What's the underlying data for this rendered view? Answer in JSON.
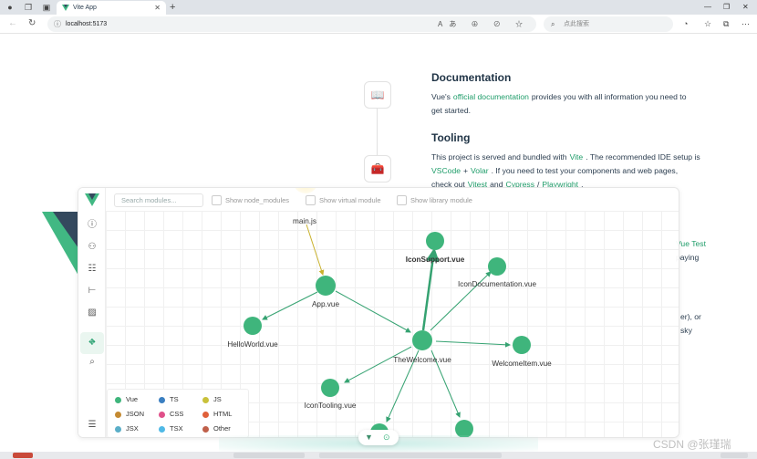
{
  "browser": {
    "tab_title": "Vite App",
    "url": "localhost:5173",
    "search_placeholder": "点此搜索"
  },
  "page": {
    "documentation_title": "Documentation",
    "doc_text_1": "Vue's",
    "doc_link": "official documentation",
    "doc_text_2": "provides you with all information you need to",
    "doc_text_3": "get started.",
    "tooling_title": "Tooling",
    "tool_line_1a": "This project is served and bundled with",
    "tool_vite": "Vite",
    "tool_line_1b": ". The recommended IDE setup is",
    "tool_vscode": "VSCode",
    "tool_plus": "+",
    "tool_volar": "Volar",
    "tool_line_2b": ". If you need to test your components and web pages,",
    "tool_line_3a": "check out",
    "tool_vitest": "Vitest",
    "tool_and": "and",
    "tool_cypress": "Cypress",
    "tool_slash": "/",
    "tool_playwright": "Playwright",
    "tool_dot": ".",
    "frag_vuetest": "Vue Test",
    "frag_paying": "paying",
    "frag_er": "er), or",
    "frag_sky": "sky"
  },
  "devtools": {
    "search_placeholder": "Search modules...",
    "show_node_modules": "Show node_modules",
    "show_virtual_module": "Show virtual module",
    "show_library_module": "Show library module",
    "nodes": {
      "main": "main.js",
      "app": "App.vue",
      "helloworld": "HelloWorld.vue",
      "welcome": "TheWelcome.vue",
      "iconsupport": "IconSupport.vue",
      "icondoc": "IconDocumentation.vue",
      "welcomeitem": "WelcomeItem.vue",
      "icontooling": "IconTooling.vue"
    },
    "legend": [
      {
        "label": "Vue",
        "color": "#3fb57c"
      },
      {
        "label": "TS",
        "color": "#3a7fc1"
      },
      {
        "label": "JS",
        "color": "#c9c13a"
      },
      {
        "label": "JSON",
        "color": "#c48a32"
      },
      {
        "label": "CSS",
        "color": "#e0508a"
      },
      {
        "label": "HTML",
        "color": "#e0603a"
      },
      {
        "label": "JSX",
        "color": "#5aaec8"
      },
      {
        "label": "TSX",
        "color": "#4fb9e6"
      },
      {
        "label": "Other",
        "color": "#c0604a"
      }
    ]
  },
  "watermark": "CSDN @张瑾瑞",
  "colors": {
    "vue_green": "#41b883",
    "link_green": "#1f9d6a",
    "edge_green": "#35a271",
    "main_edge": "#c9b22e"
  }
}
